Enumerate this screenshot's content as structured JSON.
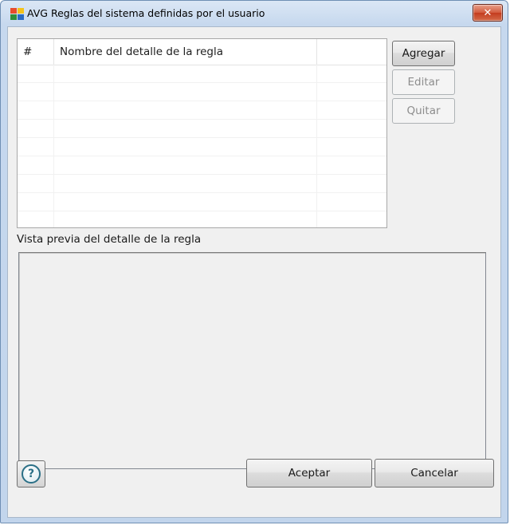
{
  "window": {
    "title": "AVG Reglas del sistema definidas por el usuario",
    "app_icon": "avg-logo-icon",
    "close_icon": "close-icon"
  },
  "rules_list": {
    "columns": [
      "#",
      "Nombre del detalle de la regla",
      ""
    ],
    "rows": []
  },
  "buttons": {
    "add": "Agregar",
    "edit": "Editar",
    "remove": "Quitar",
    "ok": "Aceptar",
    "cancel": "Cancelar",
    "help_icon": "help-icon",
    "help_glyph": "?"
  },
  "preview": {
    "label": "Vista previa del detalle de la regla",
    "text": ""
  },
  "colors": {
    "close_button": "#c43c1f",
    "title_bar": "#c6d8ee"
  }
}
